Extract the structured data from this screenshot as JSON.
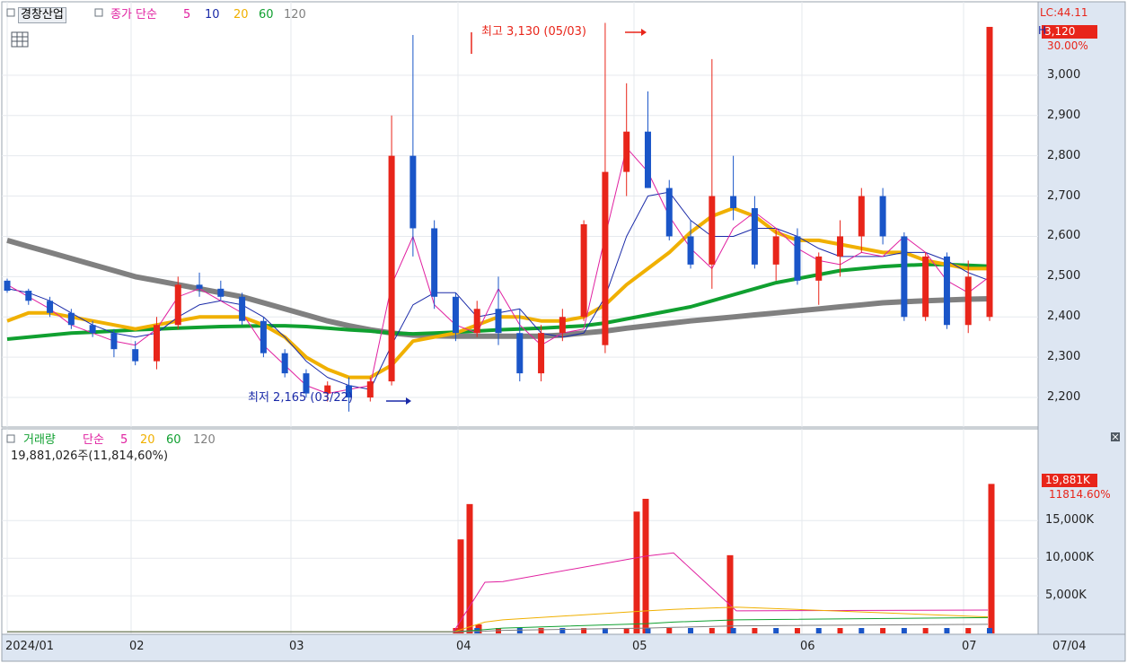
{
  "price_panel": {
    "title": "경창산업",
    "indicator_label": "종가 단순",
    "ma_periods": [
      "5",
      "10",
      "20",
      "60",
      "120"
    ],
    "ma_colors": [
      "#e020a0",
      "#1a2aa8",
      "#f0b000",
      "#10a030",
      "#808080"
    ],
    "high_annotation": "최고 3,130 (05/03)",
    "low_annotation": "최저 2,165 (03/22)",
    "lc_label": "LC:44.11",
    "h_label": "H",
    "current_price_tag": "3,120",
    "change_tag": "30.00%",
    "y_ticks": [
      "3,000",
      "2,900",
      "2,800",
      "2,700",
      "2,600",
      "2,500",
      "2,400",
      "2,300",
      "2,200"
    ]
  },
  "volume_panel": {
    "title": "거래량",
    "indicator_label": "단순",
    "ma_periods": [
      "5",
      "20",
      "60",
      "120"
    ],
    "volume_text": "19,881,026주(11,814,60%)",
    "current_volume_tag": "19,881K",
    "ratio_tag": "11814.60%",
    "y_ticks": [
      "15,000K",
      "10,000K",
      "5,000K"
    ]
  },
  "x_axis": {
    "labels": [
      "2024/01",
      "02",
      "03",
      "04",
      "05",
      "06",
      "07"
    ],
    "end_label": "07/04"
  },
  "colors": {
    "up": "#e8251a",
    "down": "#1a55c8",
    "axis_panel": "#dde6f2",
    "tag": "#e8251a"
  },
  "chart_data": [
    {
      "type": "candlestick",
      "title": "경창산업",
      "ylim": [
        2140,
        3160
      ],
      "x": [
        "2024/01",
        "02",
        "03",
        "04",
        "05",
        "06",
        "07"
      ],
      "series": [
        {
          "name": "5",
          "values": [
            2480,
            2450,
            2420,
            2380,
            2360,
            2340,
            2330,
            2370,
            2450,
            2470,
            2440,
            2410,
            2330,
            2280,
            2230,
            2210,
            2220,
            2230,
            2480,
            2600,
            2430,
            2380,
            2360,
            2470,
            2380,
            2330,
            2360,
            2370,
            2600,
            2820,
            2760,
            2650,
            2570,
            2520,
            2620,
            2660,
            2620,
            2570,
            2540,
            2530,
            2560,
            2550,
            2600,
            2560,
            2490,
            2460,
            2500
          ]
        },
        {
          "name": "10",
          "values": [
            2470,
            2460,
            2440,
            2410,
            2380,
            2360,
            2350,
            2360,
            2400,
            2430,
            2440,
            2430,
            2400,
            2350,
            2290,
            2250,
            2230,
            2220,
            2330,
            2430,
            2460,
            2460,
            2400,
            2410,
            2420,
            2360,
            2350,
            2360,
            2450,
            2600,
            2700,
            2710,
            2640,
            2600,
            2600,
            2620,
            2620,
            2600,
            2570,
            2550,
            2550,
            2550,
            2560,
            2560,
            2540,
            2510,
            2490
          ]
        },
        {
          "name": "20",
          "values": [
            2390,
            2410,
            2410,
            2400,
            2390,
            2380,
            2370,
            2380,
            2390,
            2400,
            2400,
            2400,
            2380,
            2350,
            2300,
            2270,
            2250,
            2250,
            2280,
            2340,
            2350,
            2360,
            2380,
            2400,
            2400,
            2390,
            2390,
            2400,
            2430,
            2480,
            2520,
            2560,
            2610,
            2650,
            2670,
            2650,
            2610,
            2590,
            2590,
            2580,
            2570,
            2560,
            2560,
            2540,
            2530,
            2520,
            2520
          ]
        },
        {
          "name": "60",
          "values": [
            2345,
            2350,
            2355,
            2360,
            2362,
            2365,
            2368,
            2370,
            2372,
            2374,
            2376,
            2377,
            2378,
            2378,
            2376,
            2372,
            2368,
            2365,
            2360,
            2358,
            2360,
            2362,
            2365,
            2368,
            2370,
            2372,
            2375,
            2378,
            2385,
            2395,
            2405,
            2415,
            2425,
            2440,
            2455,
            2470,
            2485,
            2495,
            2505,
            2515,
            2520,
            2525,
            2528,
            2530,
            2530,
            2528,
            2526
          ]
        },
        {
          "name": "120",
          "values": [
            2590,
            2575,
            2560,
            2545,
            2530,
            2515,
            2500,
            2490,
            2480,
            2470,
            2460,
            2450,
            2435,
            2420,
            2405,
            2390,
            2378,
            2368,
            2360,
            2355,
            2353,
            2352,
            2352,
            2352,
            2352,
            2352,
            2355,
            2360,
            2365,
            2372,
            2378,
            2384,
            2390,
            2395,
            2400,
            2405,
            2410,
            2415,
            2420,
            2425,
            2430,
            2435,
            2438,
            2440,
            2442,
            2444,
            2445
          ]
        }
      ],
      "candles_ohlc": [
        [
          2490,
          2495,
          2460,
          2465
        ],
        [
          2465,
          2470,
          2430,
          2440
        ],
        [
          2440,
          2450,
          2400,
          2410
        ],
        [
          2410,
          2420,
          2370,
          2380
        ],
        [
          2380,
          2390,
          2350,
          2360
        ],
        [
          2360,
          2370,
          2300,
          2320
        ],
        [
          2320,
          2340,
          2280,
          2290
        ],
        [
          2290,
          2400,
          2270,
          2380
        ],
        [
          2380,
          2500,
          2370,
          2480
        ],
        [
          2480,
          2510,
          2450,
          2470
        ],
        [
          2470,
          2490,
          2440,
          2450
        ],
        [
          2450,
          2460,
          2380,
          2390
        ],
        [
          2390,
          2400,
          2300,
          2310
        ],
        [
          2310,
          2320,
          2250,
          2260
        ],
        [
          2260,
          2270,
          2200,
          2210
        ],
        [
          2210,
          2240,
          2190,
          2230
        ],
        [
          2230,
          2250,
          2165,
          2200
        ],
        [
          2200,
          2250,
          2190,
          2240
        ],
        [
          2240,
          2900,
          2230,
          2800
        ],
        [
          2800,
          3100,
          2550,
          2620
        ],
        [
          2620,
          2640,
          2420,
          2450
        ],
        [
          2450,
          2460,
          2340,
          2360
        ],
        [
          2360,
          2440,
          2350,
          2420
        ],
        [
          2420,
          2500,
          2330,
          2360
        ],
        [
          2360,
          2420,
          2240,
          2260
        ],
        [
          2260,
          2380,
          2240,
          2360
        ],
        [
          2360,
          2420,
          2340,
          2400
        ],
        [
          2400,
          2640,
          2390,
          2630
        ],
        [
          2330,
          3130,
          2310,
          2760
        ],
        [
          2760,
          2980,
          2700,
          2860
        ],
        [
          2860,
          2960,
          2720,
          2720
        ],
        [
          2720,
          2740,
          2590,
          2600
        ],
        [
          2600,
          2640,
          2520,
          2530
        ],
        [
          2530,
          3040,
          2470,
          2700
        ],
        [
          2700,
          2800,
          2640,
          2670
        ],
        [
          2670,
          2700,
          2520,
          2530
        ],
        [
          2530,
          2620,
          2490,
          2600
        ],
        [
          2600,
          2620,
          2480,
          2490
        ],
        [
          2490,
          2560,
          2430,
          2550
        ],
        [
          2550,
          2640,
          2500,
          2600
        ],
        [
          2600,
          2720,
          2560,
          2700
        ],
        [
          2700,
          2720,
          2580,
          2600
        ],
        [
          2600,
          2610,
          2390,
          2400
        ],
        [
          2400,
          2560,
          2390,
          2550
        ],
        [
          2550,
          2560,
          2370,
          2380
        ],
        [
          2380,
          2540,
          2360,
          2500
        ],
        [
          2400,
          3120,
          2390,
          3120
        ]
      ]
    },
    {
      "type": "bar",
      "title": "거래량",
      "ylabel": "K",
      "ylim": [
        0,
        21000
      ],
      "categories": [
        "04/01",
        "04/02",
        "04/03",
        "05/02",
        "05/03",
        "05/20",
        "07/04"
      ],
      "values": [
        12500,
        17200,
        1200,
        16200,
        17900,
        10400,
        19881
      ],
      "series": [
        {
          "name": "5",
          "values": [
            200,
            6800,
            6900,
            10300,
            10700,
            3000,
            3100
          ]
        },
        {
          "name": "20",
          "values": [
            200,
            1500,
            1800,
            3000,
            3200,
            3500,
            2200
          ]
        },
        {
          "name": "60",
          "values": [
            200,
            500,
            700,
            1300,
            1500,
            1800,
            2100
          ]
        },
        {
          "name": "120",
          "values": [
            200,
            300,
            400,
            700,
            800,
            1000,
            1200
          ]
        }
      ]
    }
  ]
}
